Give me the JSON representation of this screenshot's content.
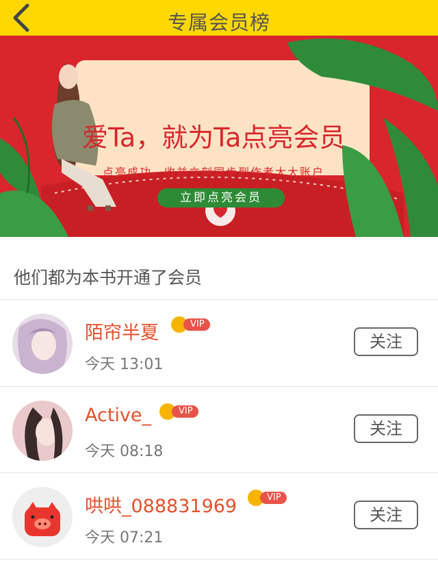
{
  "header": {
    "title": "专属会员榜"
  },
  "banner": {
    "headline": "爱Ta，就为Ta点亮会员",
    "subtitle": "点亮成功，收益立刻同步到作者大大账户",
    "cta_label": "立即点亮会员"
  },
  "section": {
    "title": "他们都为本书开通了会员"
  },
  "members": [
    {
      "name": "陌帘半夏",
      "time": "今天 13:01",
      "badge": "VIP",
      "follow_label": "关注"
    },
    {
      "name": "Active_",
      "time": "今天 08:18",
      "badge": "VIP",
      "follow_label": "关注"
    },
    {
      "name": "哄哄_088831969",
      "time": "今天 07:21",
      "badge": "VIP",
      "follow_label": "关注"
    }
  ],
  "colors": {
    "top_bar": "#ffd802",
    "banner_red": "#d8262c",
    "name": "#e4512b",
    "vip": "#e8534a",
    "cta": "#2e8b35"
  },
  "icons": {
    "back": "chevron-left-icon",
    "vip": "crown-icon"
  }
}
